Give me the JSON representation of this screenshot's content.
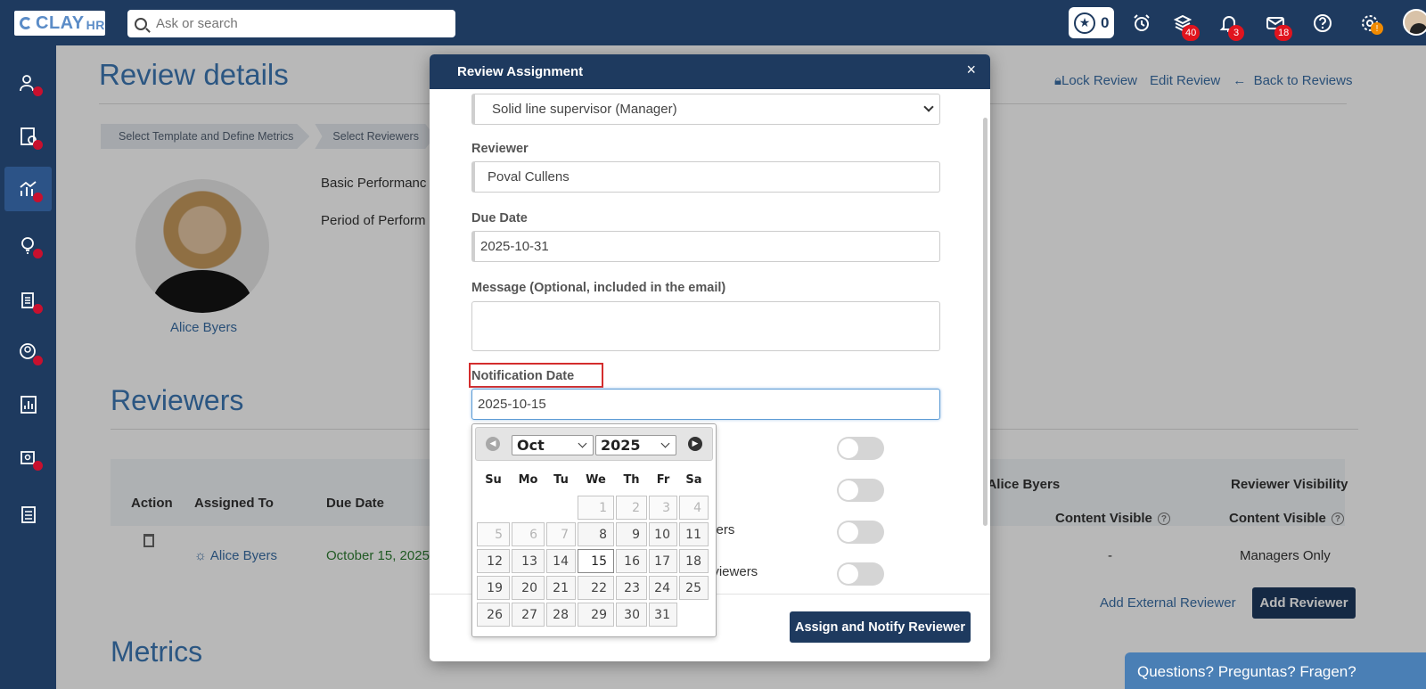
{
  "topbar": {
    "logo_main": "CLAY",
    "logo_sub": "HR",
    "search_placeholder": "Ask or search",
    "star_count": "0",
    "badges": {
      "layers": "40",
      "bell": "3",
      "mail": "18",
      "settings": "!"
    }
  },
  "page": {
    "title": "Review details",
    "links": {
      "lock": "Lock Review",
      "edit": "Edit Review",
      "back": "Back to Reviews"
    },
    "crumbs": [
      "Select Template and Define Metrics",
      "Select Reviewers"
    ],
    "employee_name": "Alice Byers",
    "info_1": "Basic Performanc",
    "info_2": "Period of Perform",
    "reviewers_title": "Reviewers",
    "metrics_title": "Metrics",
    "table": {
      "headers": {
        "action": "Action",
        "assigned": "Assigned To",
        "due": "Due Date",
        "for_alice": "r Alice Byers",
        "visibility": "Reviewer Visibility",
        "content1": "Content Visible",
        "content2": "Content Visible"
      },
      "row": {
        "assigned": "Alice Byers",
        "due": "October 15, 2025",
        "dash": "-",
        "visibility": "Managers Only"
      }
    },
    "add_external": "Add External Reviewer",
    "add_reviewer": "Add Reviewer",
    "questions": "Questions? Preguntas? Fragen?"
  },
  "modal": {
    "title": "Review Assignment",
    "close": "×",
    "relation_value": "Solid line supervisor (Manager)",
    "reviewer_label": "Reviewer",
    "reviewer_value": "Poval Cullens",
    "due_label": "Due Date",
    "due_value": "2025-10-31",
    "message_label": "Message (Optional, included in the email)",
    "notification_label": "Notification Date",
    "notification_value": "2025-10-15",
    "toggle_text_3": "yers",
    "toggle_text_4": "eviewers",
    "assign_button": "Assign and Notify Reviewer"
  },
  "datepicker": {
    "month": "Oct",
    "year": "2025",
    "dow": [
      "Su",
      "Mo",
      "Tu",
      "We",
      "Th",
      "Fr",
      "Sa"
    ],
    "selected_day": "15",
    "weeks": [
      [
        null,
        null,
        null,
        "1",
        "2",
        "3",
        "4"
      ],
      [
        "5",
        "6",
        "7",
        "8",
        "9",
        "10",
        "11"
      ],
      [
        "12",
        "13",
        "14",
        "15",
        "16",
        "17",
        "18"
      ],
      [
        "19",
        "20",
        "21",
        "22",
        "23",
        "24",
        "25"
      ],
      [
        "26",
        "27",
        "28",
        "29",
        "30",
        "31",
        null
      ]
    ],
    "other_month_cells": [
      "1",
      "2",
      "3",
      "4",
      "5",
      "6",
      "7"
    ]
  }
}
